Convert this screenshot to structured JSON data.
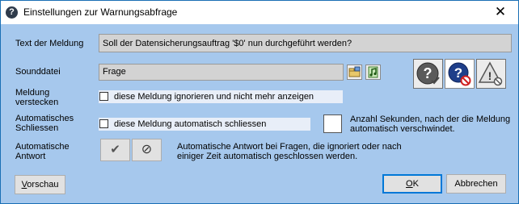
{
  "window": {
    "title": "Einstellungen zur Warnungsabfrage",
    "app_icon_glyph": "?",
    "close_glyph": "✕"
  },
  "text_meldung": {
    "label": "Text der Meldung",
    "value": "Soll der Datensicherungsauftrag '$0' nun durchgeführt werden?"
  },
  "sounddatei": {
    "label": "Sounddatei",
    "value": "Frage"
  },
  "meldung_verstecken": {
    "label_line1": "Meldung",
    "label_line2": "verstecken",
    "checkbox_label": "diese Meldung ignorieren und nicht mehr anzeigen"
  },
  "auto_schliessen": {
    "label_line1": "Automatisches",
    "label_line2": "Schliessen",
    "checkbox_label": "diese Meldung automatisch schliessen",
    "seconds_value": "",
    "hint_line1": "Anzahl Sekunden, nach der die Meldung",
    "hint_line2": "automatisch verschwindet."
  },
  "auto_antwort": {
    "label_line1": "Automatische",
    "label_line2": "Antwort",
    "desc_line1": "Automatische Antwort bei Fragen, die ignoriert oder nach",
    "desc_line2": "einiger Zeit automatisch geschlossen werden.",
    "yes_glyph": "✔",
    "no_glyph": "⊘"
  },
  "buttons": {
    "preview_label_accel": "V",
    "preview_label_rest": "orschau",
    "ok_label_accel": "O",
    "ok_label_rest": "K",
    "cancel_label": "Abbrechen"
  },
  "colors": {
    "dialog_bg": "#a6c8ed",
    "field_bg": "#d3d3d3",
    "checkbox_row_bg": "#e8eef8",
    "border_accent": "#1a6fb5"
  }
}
